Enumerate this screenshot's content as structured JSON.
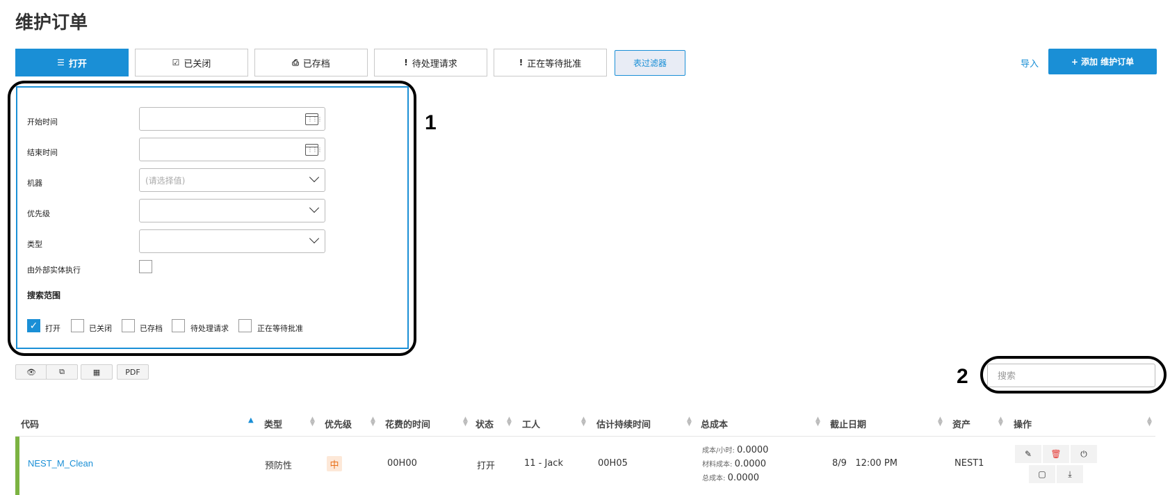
{
  "page": {
    "title": "维护订单"
  },
  "tabs": [
    {
      "label": "打开",
      "icon": "list-icon",
      "glyph": "☰"
    },
    {
      "label": "已关闭",
      "icon": "check-square-icon",
      "glyph": "☑"
    },
    {
      "label": "已存档",
      "icon": "inbox-icon",
      "glyph": "⎙"
    },
    {
      "label": "待处理请求",
      "icon": "exclamation-icon",
      "glyph": "!"
    },
    {
      "label": "正在等待批准",
      "icon": "exclamation-icon",
      "glyph": "!"
    }
  ],
  "toolbar": {
    "filter_label": "表过滤器",
    "import_label": "导入",
    "add_label": "添加 维护订单",
    "add_glyph": "+"
  },
  "filters": {
    "start_label": "开始时间",
    "start_value": "",
    "end_label": "结束时间",
    "end_value": "",
    "machine_label": "机器",
    "machine_placeholder": "(请选择值)",
    "priority_label": "优先级",
    "priority_value": "",
    "type_label": "类型",
    "type_value": "",
    "external_label": "由外部实体执行",
    "external_checked": false,
    "scope_title": "搜索范围",
    "scope": [
      {
        "label": "打开",
        "checked": true
      },
      {
        "label": "已关闭",
        "checked": false
      },
      {
        "label": "已存档",
        "checked": false
      },
      {
        "label": "待处理请求",
        "checked": false
      },
      {
        "label": "正在等待批准",
        "checked": false
      }
    ]
  },
  "annotations": {
    "one": "1",
    "two": "2"
  },
  "table_tools": [
    {
      "name": "eye-icon",
      "glyph": "👁"
    },
    {
      "name": "copy-icon",
      "glyph": "⧉"
    },
    {
      "name": "table-icon",
      "glyph": "▦"
    },
    {
      "name": "pdf-button",
      "glyph": "PDF"
    }
  ],
  "search": {
    "placeholder": "搜索",
    "value": ""
  },
  "table": {
    "headers": [
      "代码",
      "类型",
      "优先级",
      "花费的时间",
      "状态",
      "工人",
      "估计持续时间",
      "总成本",
      "截止日期",
      "资产",
      "操作"
    ],
    "rows": [
      {
        "code": "NEST_M_Clean",
        "type": "预防性",
        "priority": "中",
        "time_spent": "00H00",
        "status": "打开",
        "worker": "11 - Jack",
        "estimated_duration": "00H05",
        "cost_per_hour_label": "成本/小时:",
        "cost_per_hour": "0.0000",
        "material_cost_label": "材料成本:",
        "material_cost": "0.0000",
        "total_cost_label": "总成本:",
        "total_cost": "0.0000",
        "due_date": "8/9   12:00 PM",
        "asset": "NEST1",
        "row_color": "#7cb342"
      }
    ]
  },
  "colors": {
    "accent": "#1a8fd6",
    "priority_medium": "#e8701a",
    "row_open": "#7cb342"
  }
}
